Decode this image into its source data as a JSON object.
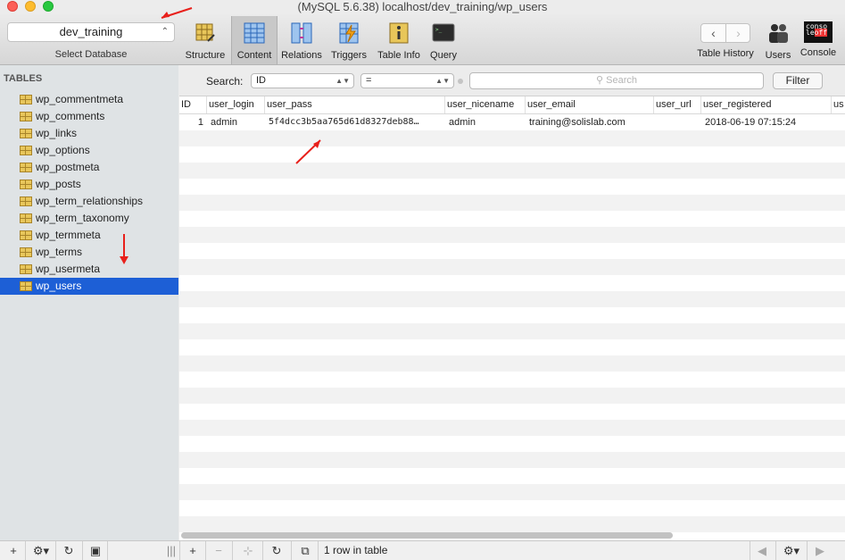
{
  "window": {
    "title": "(MySQL 5.6.38) localhost/dev_training/wp_users"
  },
  "toolbar": {
    "database": "dev_training",
    "database_label": "Select Database",
    "buttons": [
      {
        "label": "Structure",
        "icon": "structure-icon"
      },
      {
        "label": "Content",
        "icon": "content-icon",
        "active": true
      },
      {
        "label": "Relations",
        "icon": "relations-icon"
      },
      {
        "label": "Triggers",
        "icon": "triggers-icon"
      },
      {
        "label": "Table Info",
        "icon": "table-info-icon"
      },
      {
        "label": "Query",
        "icon": "query-icon"
      }
    ],
    "table_history_label": "Table History",
    "users_label": "Users",
    "console_label": "Console",
    "console_icon_text": [
      "conso",
      "le",
      "off"
    ]
  },
  "sidebar": {
    "heading": "TABLES",
    "tables": [
      "wp_commentmeta",
      "wp_comments",
      "wp_links",
      "wp_options",
      "wp_postmeta",
      "wp_posts",
      "wp_term_relationships",
      "wp_term_taxonomy",
      "wp_termmeta",
      "wp_terms",
      "wp_usermeta",
      "wp_users"
    ],
    "selected": "wp_users"
  },
  "search": {
    "label": "Search:",
    "field": "ID",
    "operator": "=",
    "placeholder": "Search",
    "filter_label": "Filter"
  },
  "table": {
    "columns": [
      "ID",
      "user_login",
      "user_pass",
      "user_nicename",
      "user_email",
      "user_url",
      "user_registered",
      "us"
    ],
    "rows": [
      [
        "1",
        "admin",
        "5f4dcc3b5aa765d61d8327deb88…",
        "admin",
        "training@solislab.com",
        "",
        "2018-06-19 07:15:24",
        ""
      ]
    ]
  },
  "status": {
    "text": "1 row in table"
  },
  "colors": {
    "accent": "#1d5fd6",
    "arrow": "#e8201b"
  }
}
